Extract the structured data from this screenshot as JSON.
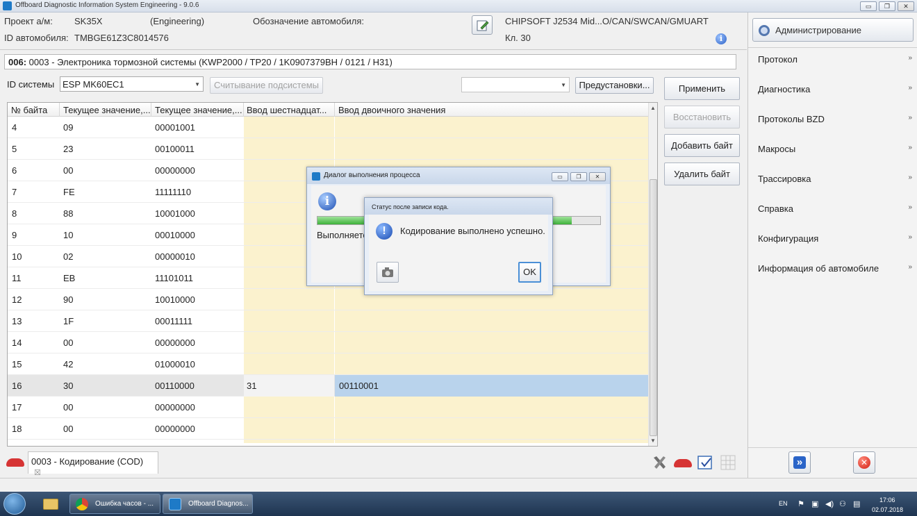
{
  "window": {
    "title": "Offboard Diagnostic Information System Engineering - 9.0.6",
    "min_glyph": "▭",
    "restore_glyph": "❐",
    "close_glyph": "✕"
  },
  "header": {
    "project_label": "Проект а/м:",
    "project_value": "SK35X",
    "project_mode": "(Engineering)",
    "vehicle_id_label": "ID автомобиля:",
    "vehicle_id_value": "TMBGE61Z3C8014576",
    "vehicle_designation_label": "Обозначение автомобиля:",
    "interface": "CHIPSOFT J2534 Mid...O/CAN/SWCAN/GMUART",
    "terminal": "Кл. 30",
    "info_glyph": "i"
  },
  "breadcrumb": {
    "code": "006:",
    "text": "0003 - Электроника тормозной системы  (KWP2000 / TP20 / 1K0907379BH / 0121 / H31)"
  },
  "controls": {
    "system_id_label": "ID системы",
    "system_id_value": "ESP MK60EC1",
    "read_subsystem_button": "Считывание подсистемы",
    "presets_button": "Предустановки...",
    "apply_button": "Применить",
    "restore_button": "Восстановить",
    "add_byte_button": "Добавить байт",
    "delete_byte_button": "Удалить байт"
  },
  "table": {
    "columns": [
      "№ байта",
      "Текущее значение,...",
      "Текущее значение,...",
      "Ввод шестнадцат...",
      "Ввод двоичного значения"
    ],
    "rows": [
      {
        "byte": "4",
        "hex": "09",
        "bin": "00001001",
        "hex_in": "",
        "bin_in": ""
      },
      {
        "byte": "5",
        "hex": "23",
        "bin": "00100011",
        "hex_in": "",
        "bin_in": ""
      },
      {
        "byte": "6",
        "hex": "00",
        "bin": "00000000",
        "hex_in": "",
        "bin_in": ""
      },
      {
        "byte": "7",
        "hex": "FE",
        "bin": "11111110",
        "hex_in": "",
        "bin_in": ""
      },
      {
        "byte": "8",
        "hex": "88",
        "bin": "10001000",
        "hex_in": "",
        "bin_in": ""
      },
      {
        "byte": "9",
        "hex": "10",
        "bin": "00010000",
        "hex_in": "",
        "bin_in": ""
      },
      {
        "byte": "10",
        "hex": "02",
        "bin": "00000010",
        "hex_in": "",
        "bin_in": ""
      },
      {
        "byte": "11",
        "hex": "EB",
        "bin": "11101011",
        "hex_in": "",
        "bin_in": ""
      },
      {
        "byte": "12",
        "hex": "90",
        "bin": "10010000",
        "hex_in": "",
        "bin_in": ""
      },
      {
        "byte": "13",
        "hex": "1F",
        "bin": "00011111",
        "hex_in": "",
        "bin_in": ""
      },
      {
        "byte": "14",
        "hex": "00",
        "bin": "00000000",
        "hex_in": "",
        "bin_in": ""
      },
      {
        "byte": "15",
        "hex": "42",
        "bin": "01000010",
        "hex_in": "",
        "bin_in": ""
      },
      {
        "byte": "16",
        "hex": "30",
        "bin": "00110000",
        "hex_in": "31",
        "bin_in": "00110001",
        "selected": true
      },
      {
        "byte": "17",
        "hex": "00",
        "bin": "00000000",
        "hex_in": "",
        "bin_in": ""
      },
      {
        "byte": "18",
        "hex": "00",
        "bin": "00000000",
        "hex_in": "",
        "bin_in": ""
      }
    ]
  },
  "right_panel": {
    "admin_button": "Администрирование",
    "chevron": "»",
    "items": [
      "Протокол",
      "Диагностика",
      "Протоколы BZD",
      "Макросы",
      "Трассировка",
      "Справка",
      "Конфигурация",
      "Информация об автомобиле"
    ],
    "forward_glyph": "»",
    "close_glyph": "✕"
  },
  "bottom_tab": {
    "label": "0003 - Кодирование (COD)",
    "close_glyph": "☒"
  },
  "progress_dialog": {
    "title": "Диалог выполнения процесса",
    "status_text": "Выполняется",
    "progress": 0.9
  },
  "status_dialog": {
    "title": "Статус после записи кода.",
    "message": "Кодирование выполнено успешно.",
    "ok_button": "OK",
    "icon_glyph": "!"
  },
  "taskbar": {
    "chrome_task": "Ошибка часов - ...",
    "odis_task": "Offboard Diagnos...",
    "lang": "EN",
    "time": "17:06",
    "date": "02.07.2018"
  }
}
